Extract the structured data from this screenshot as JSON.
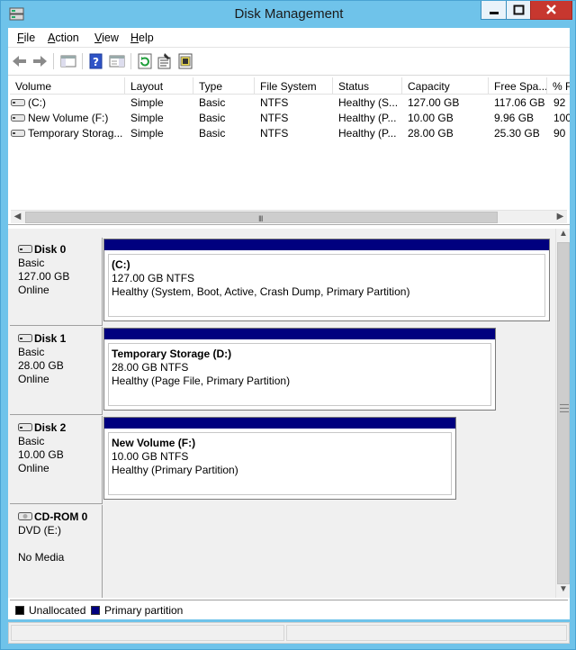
{
  "window": {
    "title": "Disk Management",
    "controls": {
      "minimize": "minimize-icon",
      "maximize": "maximize-icon",
      "close": "close-icon"
    }
  },
  "menu": [
    {
      "label": "File",
      "accel": "F",
      "rest": "ile"
    },
    {
      "label": "Action",
      "accel": "A",
      "rest": "ction"
    },
    {
      "label": "View",
      "accel": "V",
      "rest": "iew"
    },
    {
      "label": "Help",
      "accel": "H",
      "rest": "elp"
    }
  ],
  "toolbar": [
    "back-icon",
    "forward-icon",
    "show-hide-console-tree-icon",
    "help-icon",
    "show-action-pane-icon",
    "refresh-icon",
    "properties-icon",
    "help-topics-icon"
  ],
  "volume_list": {
    "columns": [
      "Volume",
      "Layout",
      "Type",
      "File System",
      "Status",
      "Capacity",
      "Free Spa...",
      "% F"
    ],
    "rows": [
      {
        "volume": "(C:)",
        "layout": "Simple",
        "type": "Basic",
        "fs": "NTFS",
        "status": "Healthy (S...",
        "capacity": "127.00 GB",
        "free": "117.06 GB",
        "pct": "92"
      },
      {
        "volume": "New Volume (F:)",
        "layout": "Simple",
        "type": "Basic",
        "fs": "NTFS",
        "status": "Healthy (P...",
        "capacity": "10.00 GB",
        "free": "9.96 GB",
        "pct": "100"
      },
      {
        "volume": "Temporary Storag...",
        "layout": "Simple",
        "type": "Basic",
        "fs": "NTFS",
        "status": "Healthy (P...",
        "capacity": "28.00 GB",
        "free": "25.30 GB",
        "pct": "90"
      }
    ],
    "scroll_grip": "III"
  },
  "disks": [
    {
      "name": "Disk 0",
      "kind": "Basic",
      "size": "127.00 GB",
      "state": "Online",
      "partition": {
        "name": "(C:)",
        "size_fs": "127.00 GB NTFS",
        "status": "Healthy (System, Boot, Active, Crash Dump, Primary Partition)"
      }
    },
    {
      "name": "Disk 1",
      "kind": "Basic",
      "size": "28.00 GB",
      "state": "Online",
      "partition": {
        "name": "Temporary Storage  (D:)",
        "size_fs": "28.00 GB NTFS",
        "status": "Healthy (Page File, Primary Partition)"
      }
    },
    {
      "name": "Disk 2",
      "kind": "Basic",
      "size": "10.00 GB",
      "state": "Online",
      "partition": {
        "name": "New Volume  (F:)",
        "size_fs": "10.00 GB NTFS",
        "status": "Healthy (Primary Partition)"
      }
    }
  ],
  "cdrom": {
    "name": "CD-ROM 0",
    "drive": "DVD (E:)",
    "media": "No Media"
  },
  "legend": [
    {
      "label": "Unallocated",
      "color": "#000000"
    },
    {
      "label": "Primary partition",
      "color": "#00007f"
    }
  ]
}
